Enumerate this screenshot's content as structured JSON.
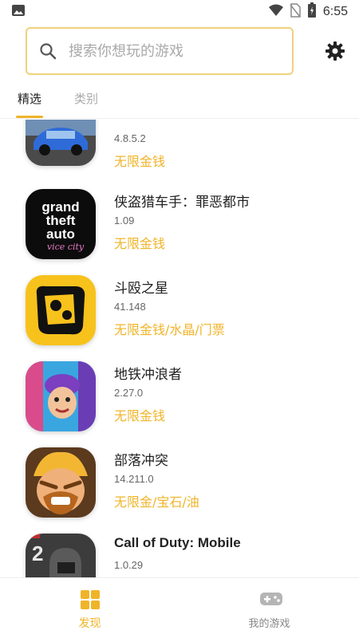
{
  "status_bar": {
    "time": "6:55",
    "icons": [
      "image-icon",
      "wifi-icon",
      "no-sim-icon",
      "battery-icon"
    ]
  },
  "search": {
    "placeholder": "搜索你想玩的游戏",
    "value": ""
  },
  "tabs": [
    {
      "label": "精选",
      "active": true
    },
    {
      "label": "类别",
      "active": false
    }
  ],
  "games": [
    {
      "title": "",
      "version": "4.8.5.2",
      "feature": "无限金钱",
      "icon": "car-parking-icon"
    },
    {
      "title": "侠盗猎车手：罪恶都市",
      "version": "1.09",
      "feature": "无限金钱",
      "icon": "gta-vice-city-icon"
    },
    {
      "title": "斗殴之星",
      "version": "41.148",
      "feature": "无限金钱/水晶/门票",
      "icon": "brawl-stars-icon"
    },
    {
      "title": "地铁冲浪者",
      "version": "2.27.0",
      "feature": "无限金钱",
      "icon": "subway-surfers-icon"
    },
    {
      "title": "部落冲突",
      "version": "14.211.0",
      "feature": "无限金/宝石/油",
      "icon": "clash-of-clans-icon"
    },
    {
      "title": "Call of Duty: Mobile",
      "version": "1.0.29",
      "feature": "",
      "icon": "call-of-duty-icon"
    }
  ],
  "bottom_nav": [
    {
      "label": "发现",
      "icon": "discover-grid-icon",
      "active": true
    },
    {
      "label": "我的游戏",
      "icon": "gamepad-icon",
      "active": false
    }
  ],
  "colors": {
    "accent": "#f0b429",
    "search_border": "#f0d27a",
    "inactive": "#888888"
  }
}
